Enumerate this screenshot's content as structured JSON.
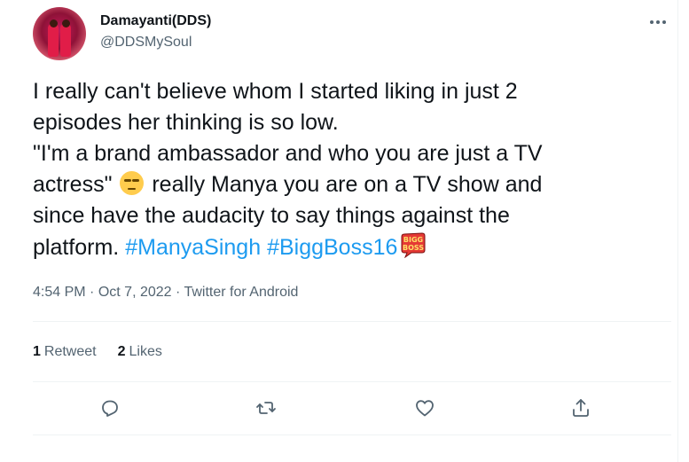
{
  "author": {
    "display_name": "Damayanti(DDS)",
    "handle": "@DDSMySoul"
  },
  "tweet": {
    "lines": [
      "I really can't believe whom I started liking in just 2",
      "episodes her thinking is so low.",
      "\"I'm a brand ambassador and who you are just a TV",
      "actress\"",
      "really Manya you are on a TV show and",
      "since have the audacity to say things against the",
      "platform."
    ],
    "hashtags": [
      "#ManyaSingh",
      "#BiggBoss16"
    ],
    "emoji": "unamused-face",
    "logo_text": "BIGG BOSS"
  },
  "meta": {
    "time": "4:54 PM",
    "date": "Oct 7, 2022",
    "source": "Twitter for Android",
    "separator": "·"
  },
  "stats": {
    "retweets_count": "1",
    "retweets_label": "Retweet",
    "likes_count": "2",
    "likes_label": "Likes"
  },
  "icons": {
    "more": "more-icon",
    "reply": "reply-icon",
    "retweet": "retweet-icon",
    "like": "heart-icon",
    "share": "share-icon"
  },
  "colors": {
    "hashtag": "#1d9bf0",
    "text": "#0f1419",
    "secondary": "#536471"
  }
}
